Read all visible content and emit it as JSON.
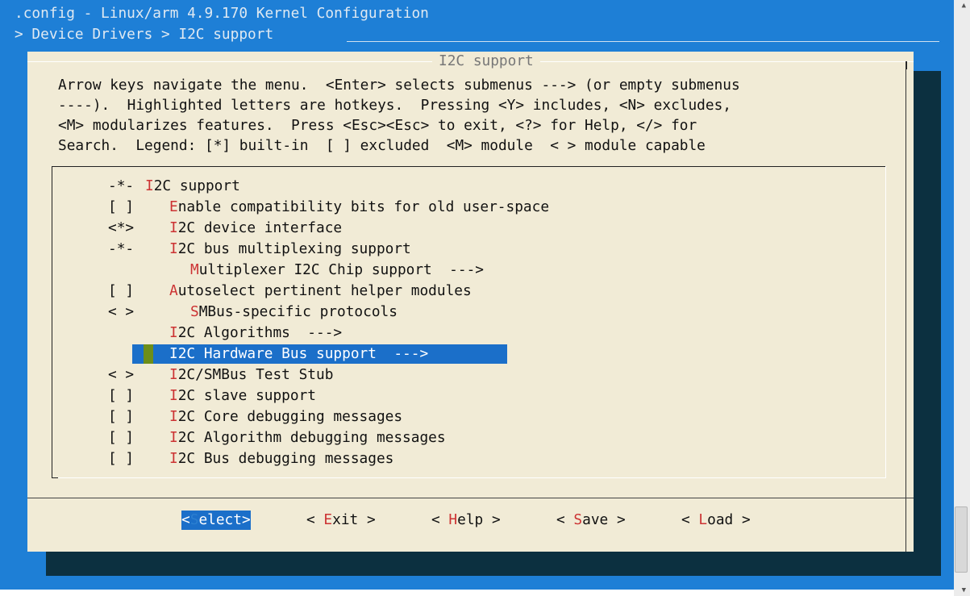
{
  "window": {
    "title": ".config - Linux/arm 4.9.170 Kernel Configuration",
    "breadcrumb": "> Device Drivers > I2C support "
  },
  "dialog": {
    "title": "I2C support",
    "instructions": [
      "Arrow keys navigate the menu.  <Enter> selects submenus ---> (or empty submenus",
      "----).  Highlighted letters are hotkeys.  Pressing <Y> includes, <N> excludes,",
      "<M> modularizes features.  Press <Esc><Esc> to exit, <?> for Help, </> for",
      "Search.  Legend: [*] built-in  [ ] excluded  <M> module  < > module capable"
    ]
  },
  "menu": {
    "items": [
      {
        "prefix": "-*-",
        "hot": "I",
        "rest": "2C support",
        "indent": 0
      },
      {
        "prefix": "[ ]",
        "hot": "E",
        "rest": "nable compatibility bits for old user-space",
        "indent": 1
      },
      {
        "prefix": "<*>",
        "hot": "I",
        "rest": "2C device interface",
        "indent": 1
      },
      {
        "prefix": "-*-",
        "hot": "I",
        "rest": "2C bus multiplexing support",
        "indent": 1
      },
      {
        "prefix": "",
        "hot": "M",
        "rest": "ultiplexer I2C Chip support  --->",
        "indent": 2
      },
      {
        "prefix": "[ ]",
        "hot": "A",
        "rest": "utoselect pertinent helper modules",
        "indent": 1
      },
      {
        "prefix": "< >",
        "hot": "S",
        "rest": "MBus-specific protocols",
        "indent": 2
      },
      {
        "prefix": "",
        "hot": "I",
        "rest": "2C Algorithms  --->",
        "indent": 1
      },
      {
        "prefix": "",
        "hot": "I",
        "rest": "2C Hardware Bus support  --->",
        "indent": 1,
        "selected": true
      },
      {
        "prefix": "< >",
        "hot": "I",
        "rest": "2C/SMBus Test Stub",
        "indent": 1
      },
      {
        "prefix": "[ ]",
        "hot": "I",
        "rest": "2C slave support",
        "indent": 1
      },
      {
        "prefix": "[ ]",
        "hot": "I",
        "rest": "2C Core debugging messages",
        "indent": 1
      },
      {
        "prefix": "[ ]",
        "hot": "I",
        "rest": "2C Algorithm debugging messages",
        "indent": 1
      },
      {
        "prefix": "[ ]",
        "hot": "I",
        "rest": "2C Bus debugging messages",
        "indent": 1
      }
    ]
  },
  "buttons": {
    "select": {
      "pre": "<",
      "hot": "S",
      "rest": "elect>"
    },
    "exit": {
      "pre": "< ",
      "hot": "E",
      "rest": "xit >"
    },
    "help": {
      "pre": "< ",
      "hot": "H",
      "rest": "elp >"
    },
    "save": {
      "pre": "< ",
      "hot": "S",
      "rest": "ave >"
    },
    "load": {
      "pre": "< ",
      "hot": "L",
      "rest": "oad >"
    }
  },
  "colors": {
    "background": "#1e7fd6",
    "dialog": "#f1ebd6",
    "selection": "#1b6fc9",
    "hotkey": "#cc3333",
    "shadow": "#0c3040"
  }
}
